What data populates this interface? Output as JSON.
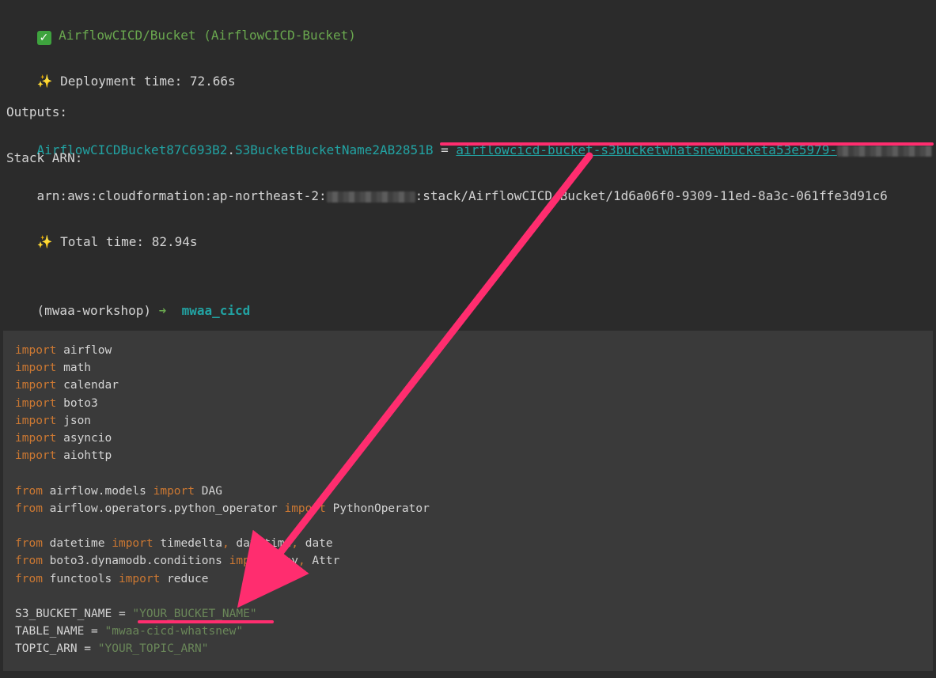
{
  "terminal": {
    "deploy_title": "AirflowCICD/Bucket (AirflowCICD-Bucket)",
    "deploy_time": "Deployment time: 72.66s",
    "outputs_label": "Outputs:",
    "output_key_a": "AirflowCICDBucket87C693B2",
    "output_key_b": "S3BucketBucketName2AB2851B",
    "equals": " = ",
    "output_value": "airflowcicd-bucket-s3bucketwhatsnewbucketa53e5979-",
    "stack_arn_label": "Stack ARN:",
    "arn_prefix": "arn:aws:cloudformation:ap-northeast-2:",
    "arn_suffix": ":stack/AirflowCICD-Bucket/1d6a06f0-9309-11ed-8a3c-061ffe3d91c6",
    "total_time": "Total time: 82.94s",
    "prompt_env": "(mwaa-workshop)",
    "prompt_arrow": "➜",
    "prompt_dir": "mwaa_cicd"
  },
  "code": {
    "imports": [
      "airflow",
      "math",
      "calendar",
      "boto3",
      "json",
      "asyncio",
      "aiohttp"
    ],
    "from_lines": [
      {
        "module": "airflow.models",
        "names": "DAG"
      },
      {
        "module": "airflow.operators.python_operator",
        "names": "PythonOperator"
      }
    ],
    "from_lines2": [
      {
        "module": "datetime",
        "names": "timedelta, datetime, date"
      },
      {
        "module": "boto3.dynamodb.conditions",
        "names": "Key, Attr"
      },
      {
        "module": "functools",
        "names": "reduce"
      }
    ],
    "assignments": [
      {
        "name": "S3_BUCKET_NAME",
        "value": "\"YOUR_BUCKET_NAME\""
      },
      {
        "name": "TABLE_NAME",
        "value": "\"mwaa-cicd-whatsnew\""
      },
      {
        "name": "TOPIC_ARN",
        "value": "\"YOUR_TOPIC_ARN\""
      }
    ],
    "keywords": {
      "import": "import",
      "from": "from",
      "eq": " = "
    }
  },
  "colors": {
    "annotation": "#ff2d6f",
    "keyword": "#cc7832",
    "string": "#6a8759",
    "teal": "#22a3a3",
    "green": "#6aa84f"
  }
}
